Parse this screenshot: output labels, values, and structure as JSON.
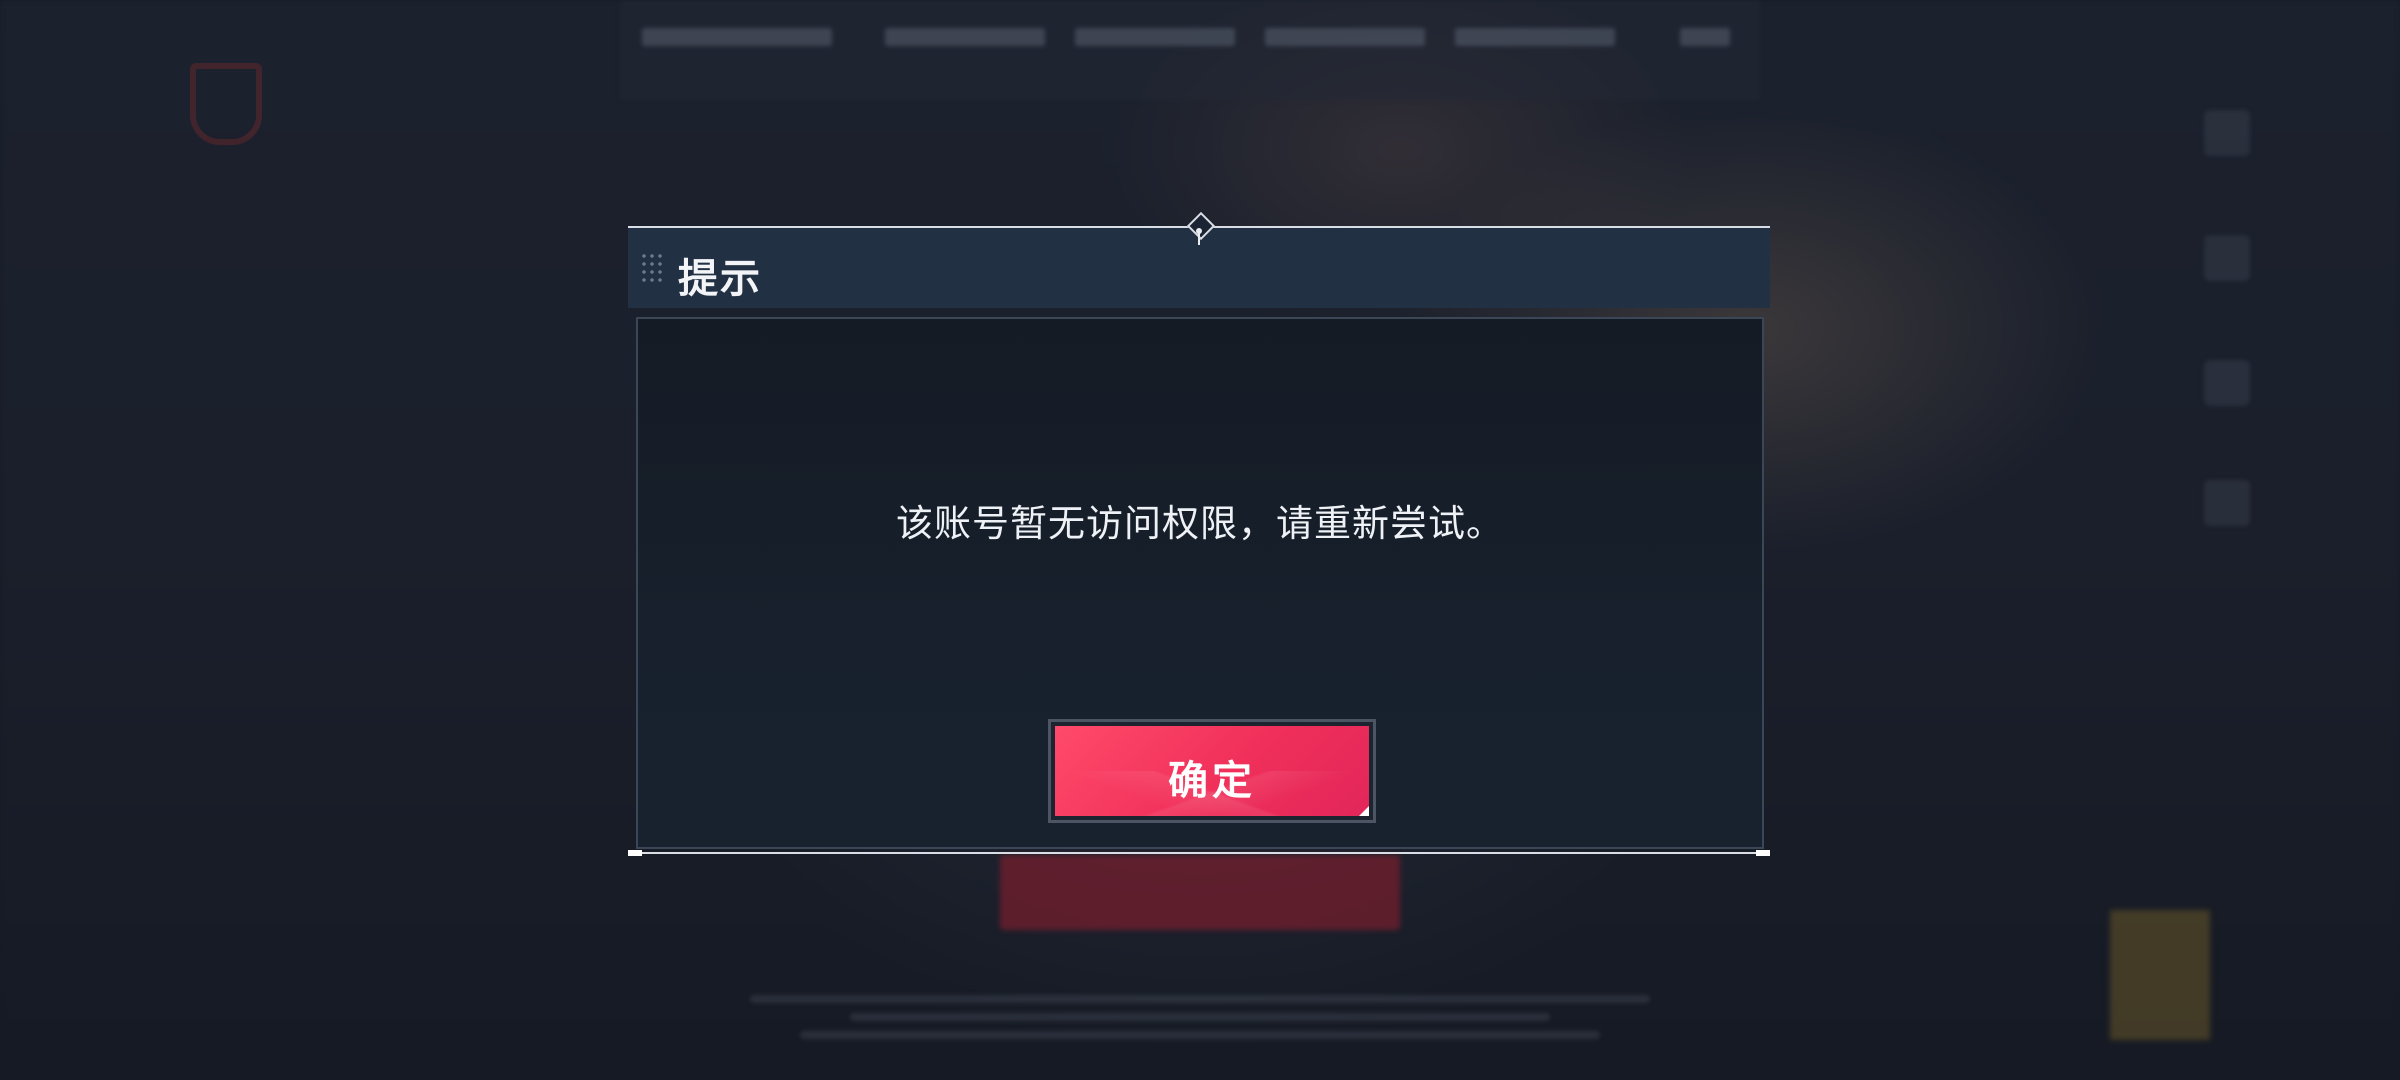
{
  "dialog": {
    "title": "提示",
    "message": "该账号暂无访问权限，请重新尝试。",
    "confirm_label": "确定"
  },
  "colors": {
    "header_bg": "#213042",
    "body_bg": "#161d28",
    "border": "#3b4757",
    "button": "#f0305a",
    "text": "#eef1f5"
  },
  "icons": [
    "drag-grip-icon",
    "diamond-ornament-icon"
  ]
}
